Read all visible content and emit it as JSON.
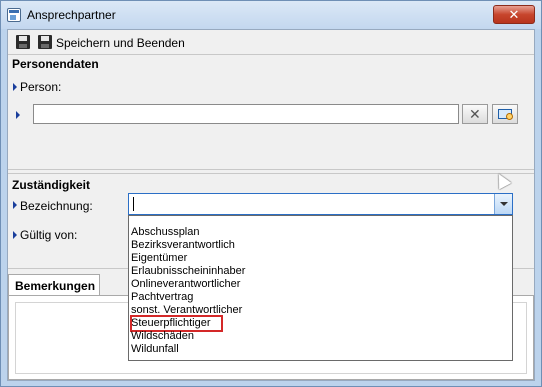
{
  "window": {
    "title": "Ansprechpartner",
    "close_label": "✕"
  },
  "toolbar": {
    "save_label": "Speichern und Beenden"
  },
  "personendaten": {
    "group_title": "Personendaten",
    "person_label": "Person:",
    "person_value": ""
  },
  "zustaendigkeit": {
    "group_title": "Zuständigkeit",
    "bezeichnung_label": "Bezeichnung:",
    "gueltig_label": "Gültig von:",
    "bezeichnung_value": ""
  },
  "dropdown": {
    "items": [
      "Abschussplan",
      "Bezirksverantwortlich",
      "Eigentümer",
      "Erlaubnisscheininhaber",
      "Onlineverantwortlicher",
      "Pachtvertrag",
      "sonst. Verantwortlicher",
      "Steuerpflichtiger",
      "Wildschäden",
      "Wildunfall"
    ],
    "highlighted": "Steuerpflichtiger"
  },
  "tabs": {
    "bemerkungen": "Bemerkungen"
  },
  "colors": {
    "accent": "#2b6fc6",
    "highlight_box": "#d42828",
    "marker": "#1a3e9c"
  }
}
